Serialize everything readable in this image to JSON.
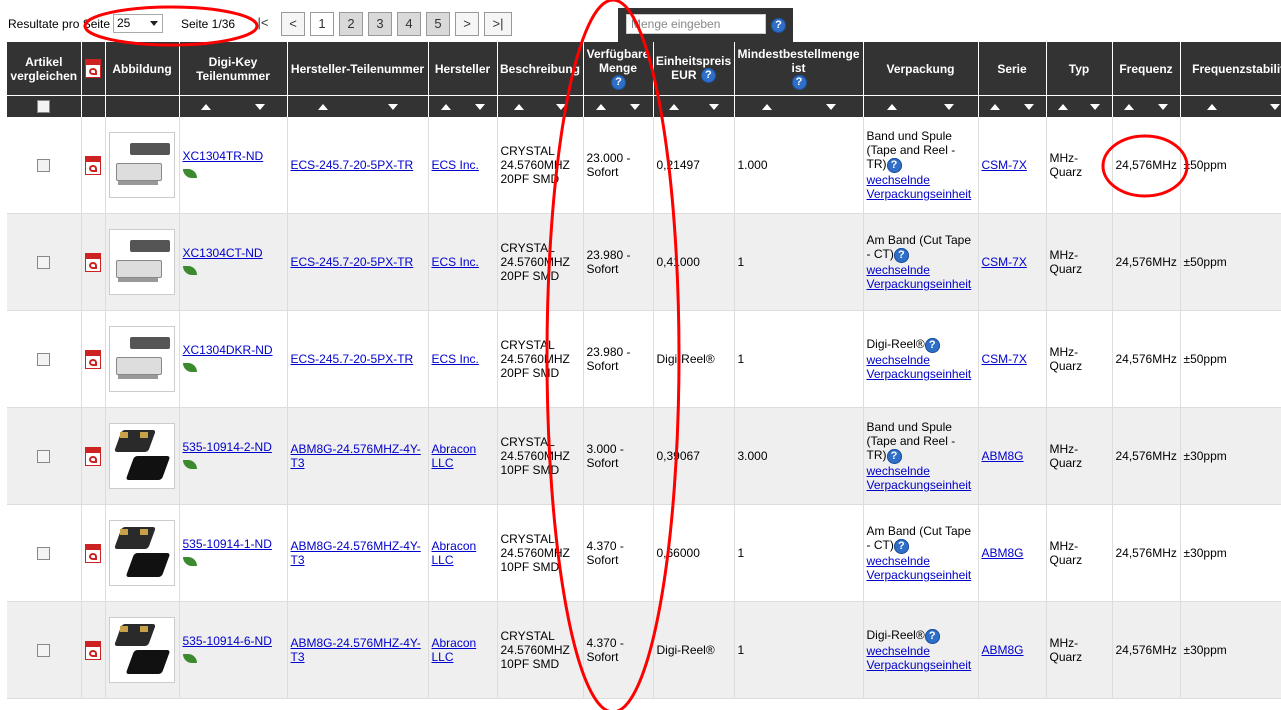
{
  "topbar": {
    "results_per_page_label": "Resultate pro Seite",
    "results_per_page_value": "25",
    "page_info": "Seite 1/36",
    "first_label": "|<",
    "prev_label": "<",
    "pages": [
      "1",
      "2",
      "3",
      "4",
      "5"
    ],
    "next_label": ">",
    "last_label": ">|",
    "qty_placeholder": "Menge eingeben",
    "help_glyph": "?"
  },
  "columns": {
    "compare": "Artikel vergleichen",
    "image": "Abbildung",
    "digikey": "Digi-Key Teilenummer",
    "mfr_pn": "Hersteller-Teilenummer",
    "mfr": "Hersteller",
    "desc": "Beschreibung",
    "avail": "Verfügbare Menge",
    "price": "Einheitspreis EUR",
    "minqty": "Mindestbestellmenge ist",
    "pack": "Verpackung",
    "series": "Serie",
    "type": "Typ",
    "freq": "Frequenz",
    "stab": "Frequenzstabilität"
  },
  "rows": [
    {
      "dk": "XC1304TR-ND",
      "mpn": "ECS-245.7-20-5PX-TR",
      "mfr": "ECS Inc.",
      "desc": "CRYSTAL 24.5760MHZ 20PF SMD",
      "avail": "23.000 - Sofort",
      "price": "0,21497",
      "min": "1.000",
      "pack": "Band und Spule (Tape and Reel - TR)",
      "pack_link": "wechselnde Verpackungseinheit",
      "series": "CSM-7X",
      "type": "MHz-Quarz",
      "freq": "24,576MHz",
      "stab": "±50ppm",
      "img": "a"
    },
    {
      "dk": "XC1304CT-ND",
      "mpn": "ECS-245.7-20-5PX-TR",
      "mfr": "ECS Inc.",
      "desc": "CRYSTAL 24.5760MHZ 20PF SMD",
      "avail": "23.980 - Sofort",
      "price": "0,41000",
      "min": "1",
      "pack": "Am Band (Cut Tape - CT)",
      "pack_link": "wechselnde Verpackungseinheit",
      "series": "CSM-7X",
      "type": "MHz-Quarz",
      "freq": "24,576MHz",
      "stab": "±50ppm",
      "img": "a"
    },
    {
      "dk": "XC1304DKR-ND",
      "mpn": "ECS-245.7-20-5PX-TR",
      "mfr": "ECS Inc.",
      "desc": "CRYSTAL 24.5760MHZ 20PF SMD",
      "avail": "23.980 - Sofort",
      "price": "Digi-Reel®",
      "min": "1",
      "pack": "Digi-Reel®",
      "pack_link": "wechselnde Verpackungseinheit",
      "series": "CSM-7X",
      "type": "MHz-Quarz",
      "freq": "24,576MHz",
      "stab": "±50ppm",
      "img": "a"
    },
    {
      "dk": "535-10914-2-ND",
      "mpn": "ABM8G-24.576MHZ-4Y-T3",
      "mfr": "Abracon LLC",
      "desc": "CRYSTAL 24.5760MHZ 10PF SMD",
      "avail": "3.000 - Sofort",
      "price": "0,39067",
      "min": "3.000",
      "pack": "Band und Spule (Tape and Reel - TR)",
      "pack_link": "wechselnde Verpackungseinheit",
      "series": "ABM8G",
      "type": "MHz-Quarz",
      "freq": "24,576MHz",
      "stab": "±30ppm",
      "img": "b"
    },
    {
      "dk": "535-10914-1-ND",
      "mpn": "ABM8G-24.576MHZ-4Y-T3",
      "mfr": "Abracon LLC",
      "desc": "CRYSTAL 24.5760MHZ 10PF SMD",
      "avail": "4.370 - Sofort",
      "price": "0,66000",
      "min": "1",
      "pack": "Am Band (Cut Tape - CT)",
      "pack_link": "wechselnde Verpackungseinheit",
      "series": "ABM8G",
      "type": "MHz-Quarz",
      "freq": "24,576MHz",
      "stab": "±30ppm",
      "img": "b"
    },
    {
      "dk": "535-10914-6-ND",
      "mpn": "ABM8G-24.576MHZ-4Y-T3",
      "mfr": "Abracon LLC",
      "desc": "CRYSTAL 24.5760MHZ 10PF SMD",
      "avail": "4.370 - Sofort",
      "price": "Digi-Reel®",
      "min": "1",
      "pack": "Digi-Reel®",
      "pack_link": "wechselnde Verpackungseinheit",
      "series": "ABM8G",
      "type": "MHz-Quarz",
      "freq": "24,576MHz",
      "stab": "±30ppm",
      "img": "b"
    }
  ],
  "colors": {
    "header_bg": "#333333",
    "link": "#0000cc",
    "annotation": "#ff0000"
  }
}
